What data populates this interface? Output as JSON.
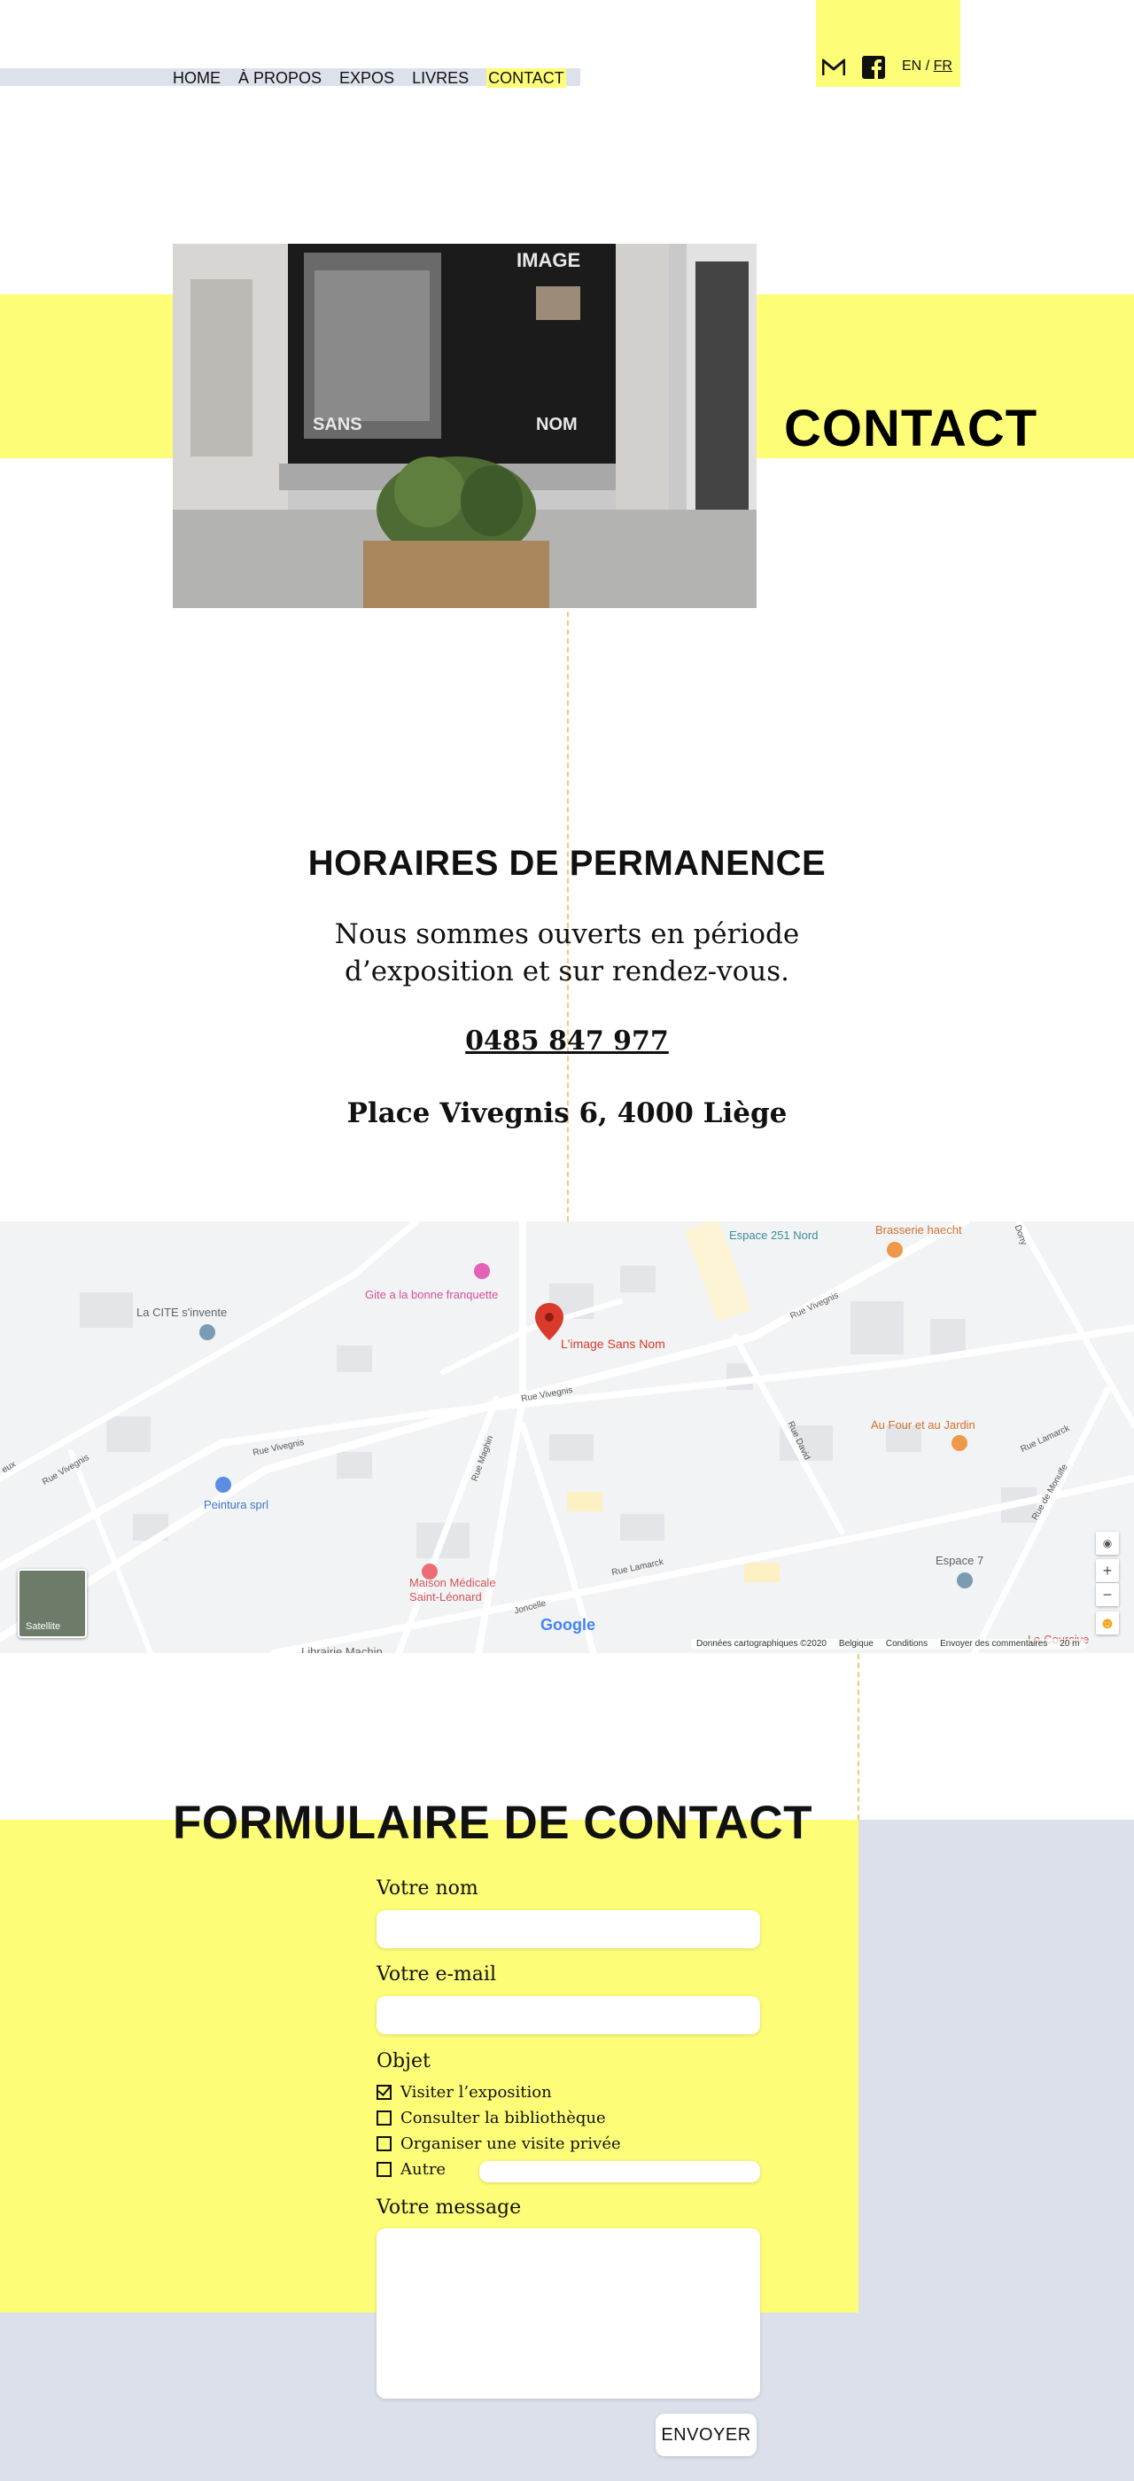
{
  "nav": {
    "items": [
      {
        "label": "HOME"
      },
      {
        "label": "À PROPOS"
      },
      {
        "label": "EXPOS"
      },
      {
        "label": "LIVRES"
      },
      {
        "label": "CONTACT",
        "active": true
      }
    ]
  },
  "social": {
    "icons": [
      "gmail-icon",
      "facebook-icon"
    ]
  },
  "lang": {
    "en": "EN",
    "separator": "/",
    "fr": "FR",
    "current": "FR"
  },
  "hero": {
    "title": "CONTACT",
    "photo_texts": {
      "top": "IMAGE",
      "left": "SANS",
      "right": "NOM"
    }
  },
  "info": {
    "hours_title": "HORAIRES DE PERMANENCE",
    "hours_text": "Nous sommes ouverts en période d’exposition et sur rendez-vous.",
    "phone": "0485 847 977",
    "address": "Place Vivegnis 6, 4000 Liège"
  },
  "map": {
    "places": {
      "marker": "L'image Sans Nom",
      "cite": "La CITE s'invente",
      "gite": "Gite a la bonne franquette",
      "espace251": "Espace 251 Nord",
      "brasserie": "Brasserie haecht",
      "four": "Au Four et au Jardin",
      "peintura": "Peintura sprl",
      "maison": "Maison Médicale Saint-Léonard",
      "espace7": "Espace 7",
      "courtisane": "La Coursive",
      "librairie": "Librairie Machin"
    },
    "roads": {
      "vivegnis1": "Rue Vivegnis",
      "vivegnis2": "Rue Vivegnis",
      "vivegnis3": "Rue Vivegnis",
      "vivegnis4": "Rue Vivegnis",
      "lamarck1": "Rue Lamarck",
      "lamarck2": "Rue Lamarck",
      "david": "Rue David",
      "maghin": "Rue Maghin",
      "monulfe": "Rue de Monulfe",
      "joncelle": "Joncelle",
      "dony": "Dony",
      "eux": "eux"
    },
    "satellite_label": "Satellite",
    "google_logo": "Google",
    "footer": {
      "data": "Données cartographiques ©2020",
      "country": "Belgique",
      "terms": "Conditions",
      "feedback": "Envoyer des commentaires",
      "scale": "20 m"
    },
    "controls": {
      "zoom_in": "+",
      "zoom_out": "−"
    }
  },
  "form": {
    "title": "FORMULAIRE DE CONTACT",
    "name_label": "Votre nom",
    "name_value": "",
    "email_label": "Votre e-mail",
    "email_value": "",
    "subject_label": "Objet",
    "options": [
      {
        "label": "Visiter l’exposition",
        "checked": true
      },
      {
        "label": "Consulter la bibliothèque",
        "checked": false
      },
      {
        "label": "Organiser une visite privée",
        "checked": false
      },
      {
        "label": "Autre",
        "checked": false
      }
    ],
    "other_value": "",
    "message_label": "Votre message",
    "message_value": "",
    "submit": "ENVOYER"
  },
  "colors": {
    "yellow": "#fdfd78",
    "blue_grey": "#dbe0ea",
    "dash_orange": "#f6c67c",
    "map_marker": "#d93a2b"
  }
}
